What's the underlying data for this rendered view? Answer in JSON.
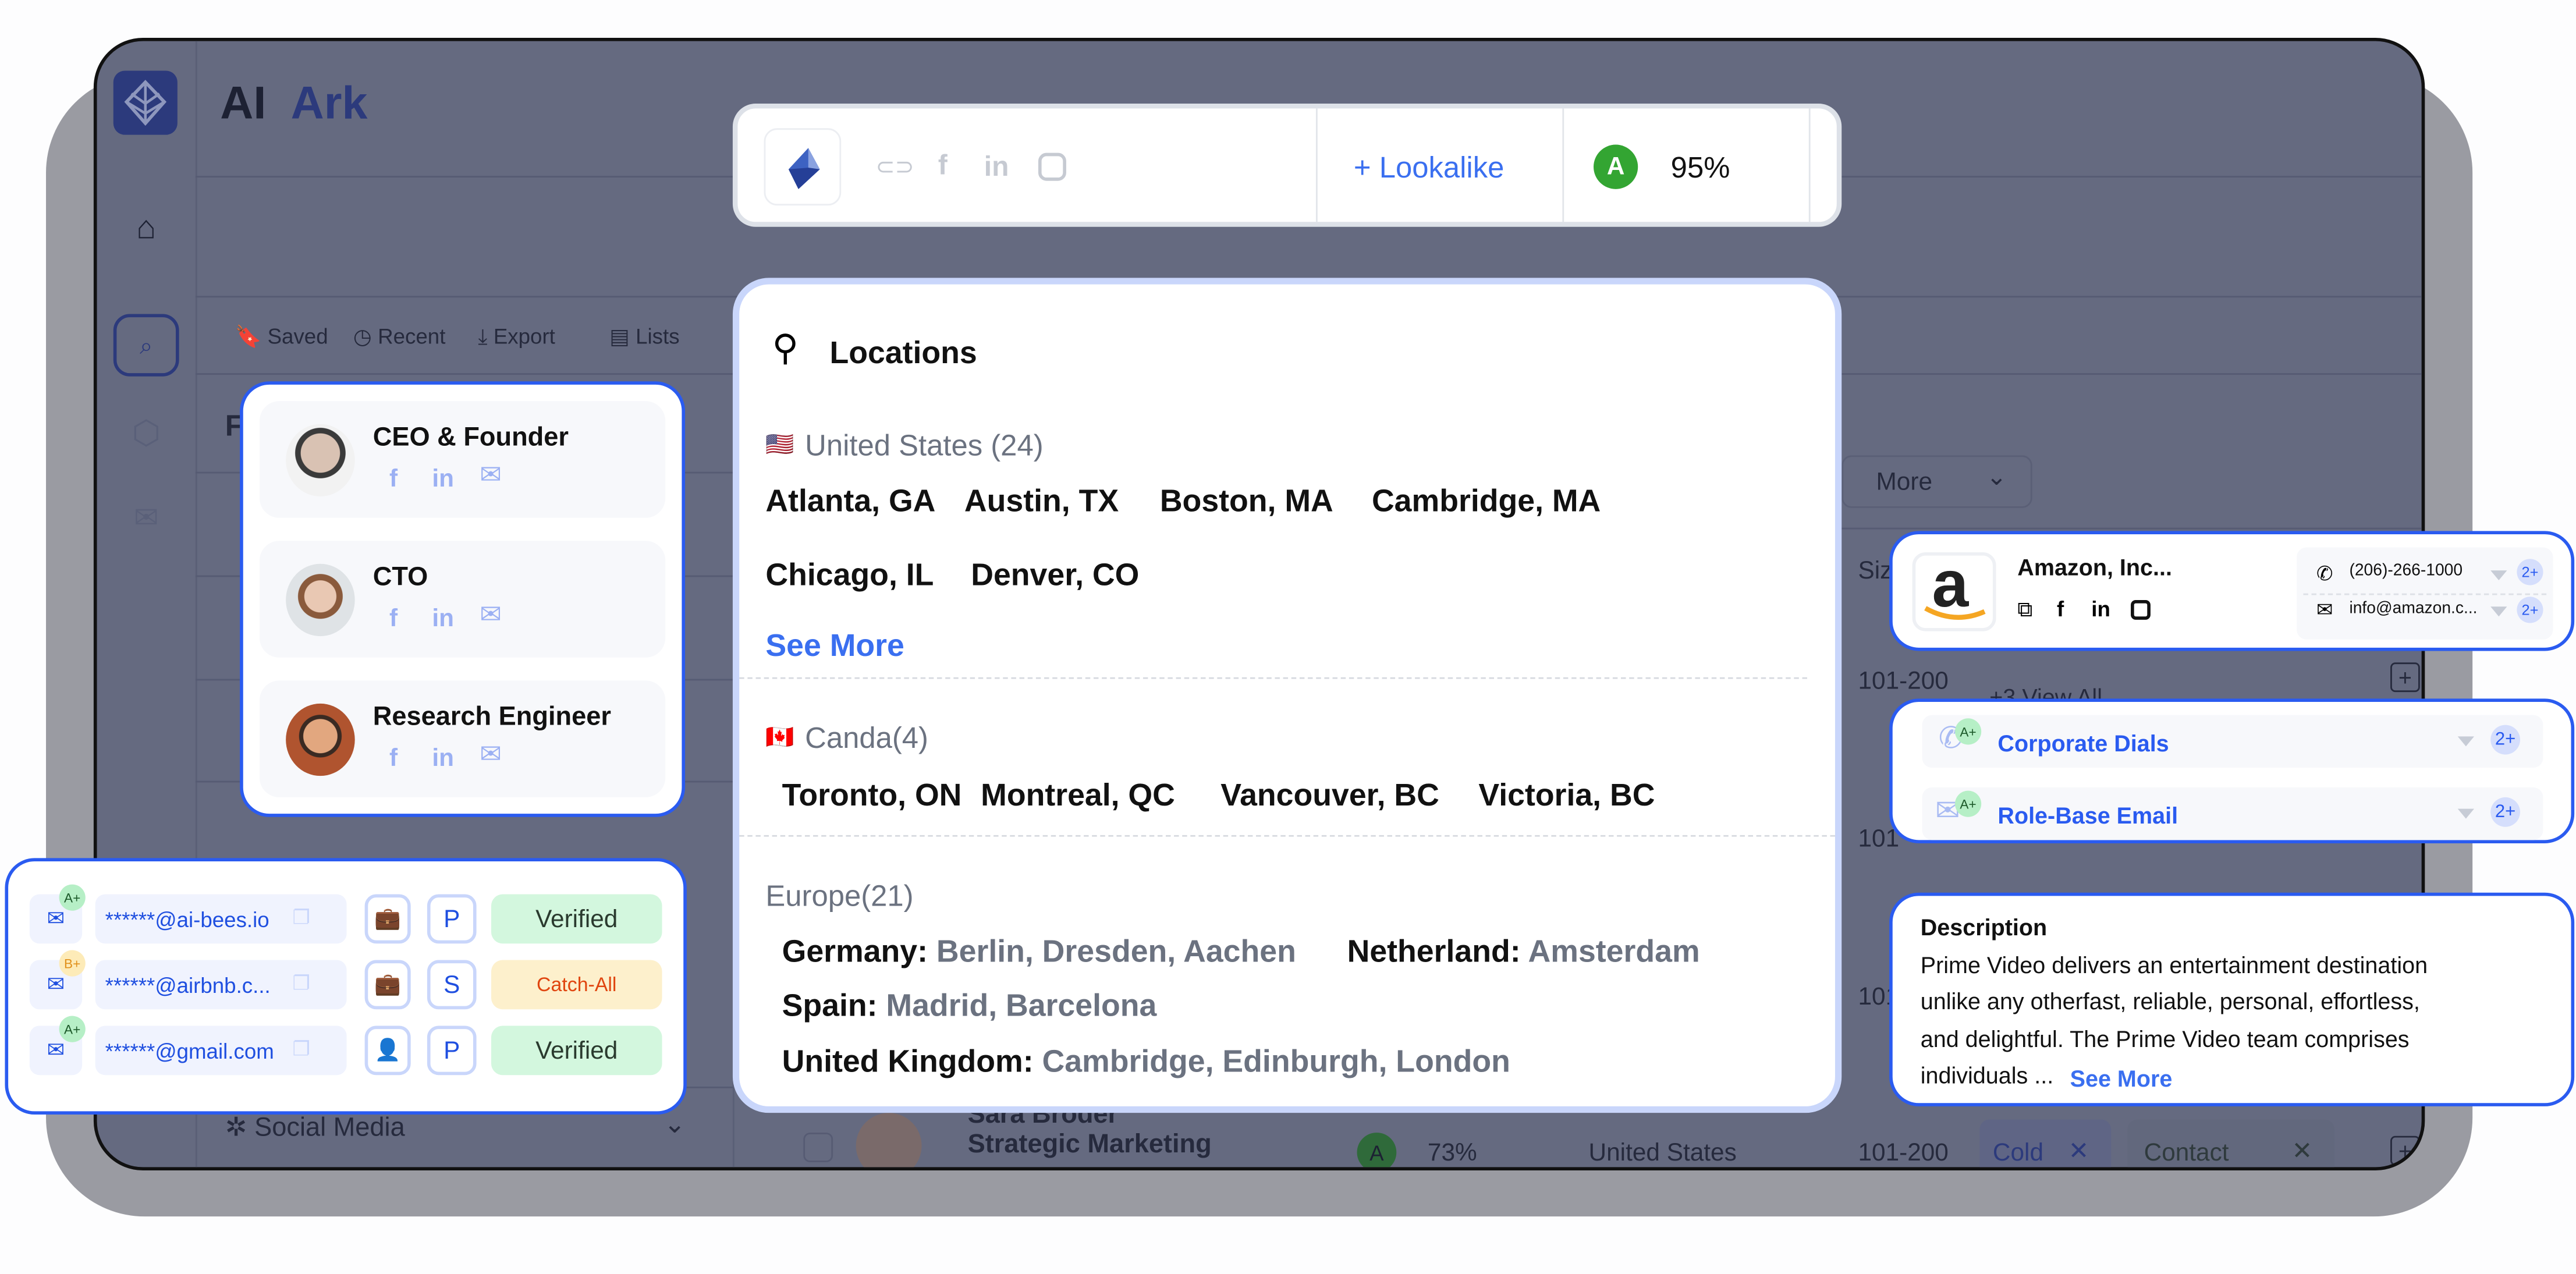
{
  "app": {
    "brand_ai": "AI",
    "brand_ark": "Ark"
  },
  "toolbar": {
    "saved": "Saved",
    "recent": "Recent",
    "export": "Export",
    "lists": "Lists"
  },
  "filters": {
    "heading_partial": "F",
    "social_media": "Social Media"
  },
  "table": {
    "more": "More",
    "size_header": "Siz",
    "rows": [
      {
        "size": "101-200",
        "tag": "+3 View All"
      },
      {
        "size": "101"
      },
      {
        "size": "101"
      },
      {
        "name_partial": "Sara Broder",
        "dept": "Strategic Marketing",
        "grade": "A",
        "score": "73%",
        "country": "United States",
        "size": "101-200",
        "tag1": "Cold",
        "tag2": "Contact"
      }
    ]
  },
  "company_bar": {
    "lookalike": "Lookalike",
    "grade": "A",
    "score": "95%"
  },
  "locations": {
    "title": "Locations",
    "us": {
      "flag": "🇺🇸",
      "label": "United States (24)",
      "cities": [
        "Atlanta, GA",
        "Austin, TX",
        "Boston, MA",
        "Cambridge, MA",
        "Chicago, IL",
        "Denver, CO"
      ],
      "see_more": "See More"
    },
    "ca": {
      "flag": "🇨🇦",
      "label": "Canda(4)",
      "cities": [
        "Toronto, ON",
        "Montreal, QC",
        "Vancouver, BC",
        "Victoria, BC"
      ]
    },
    "eu": {
      "label": "Europe(21)",
      "countries": [
        {
          "name": "Germany:",
          "cities": "Berlin, Dresden, Aachen"
        },
        {
          "name": "Netherland:",
          "cities": "Amsterdam"
        },
        {
          "name": "Spain:",
          "cities": "Madrid, Barcelona"
        },
        {
          "name": "United Kingdom:",
          "cities": "Cambridge, Edinburgh, London"
        }
      ]
    }
  },
  "people": [
    {
      "title": "CEO & Founder"
    },
    {
      "title": "CTO"
    },
    {
      "title": "Research Engineer"
    }
  ],
  "emails": [
    {
      "grade": "A+",
      "email": "******@ai-bees.io",
      "type": "briefcase",
      "letter": "P",
      "status": "Verified"
    },
    {
      "grade": "B+",
      "email": "******@airbnb.c...",
      "type": "briefcase",
      "letter": "S",
      "status": "Catch-All"
    },
    {
      "grade": "A+",
      "email": "******@gmail.com",
      "type": "person",
      "letter": "P",
      "status": "Verified"
    }
  ],
  "amazon": {
    "name": "Amazon, Inc...",
    "phone": "(206)-266-1000",
    "email": "info@amazon.c...",
    "phone_count": "2+",
    "email_count": "2+"
  },
  "dials": [
    {
      "grade": "A+",
      "label": "Corporate Dials",
      "count": "2+"
    },
    {
      "grade": "A+",
      "label": "Role-Base Email",
      "count": "2+"
    }
  ],
  "description": {
    "title": "Description",
    "lines": [
      "Prime Video delivers an entertainment destination",
      "unlike any otherfast, reliable, personal, effortless,",
      "and delightful. The Prime Video team comprises",
      "individuals ..."
    ],
    "see_more": "See More"
  },
  "colors": {
    "accent": "#2a5bf0",
    "verified_bg": "#d3f7de",
    "catchall_bg": "#fdf0cc",
    "catchall_text": "#e0450f",
    "grade_green": "#33a532"
  }
}
